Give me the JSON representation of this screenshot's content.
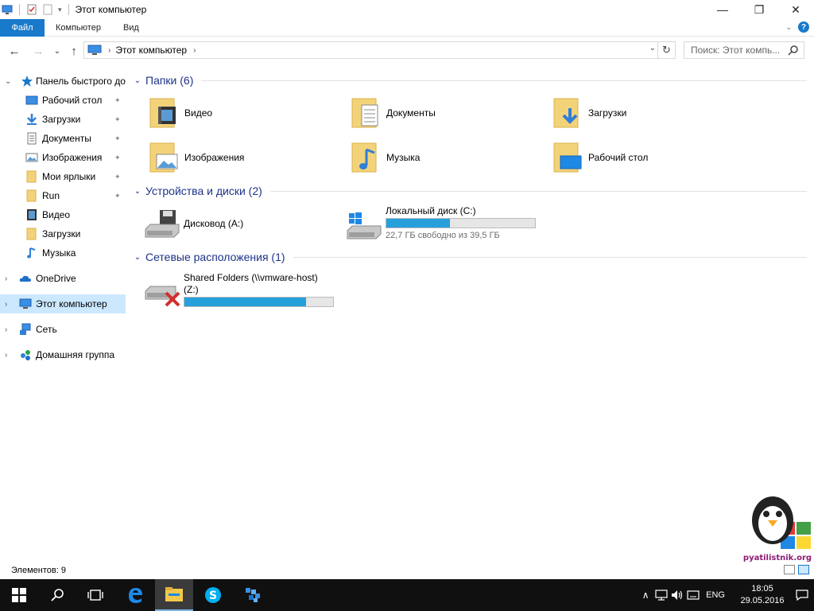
{
  "window": {
    "title": "Этот компьютер",
    "min_glyph": "—",
    "max_glyph": "❐",
    "close_glyph": "✕"
  },
  "ribbon": {
    "tabs": [
      "Файл",
      "Компьютер",
      "Вид"
    ],
    "help_glyph": "?",
    "expand_glyph": "⌄"
  },
  "nav": {
    "back_glyph": "←",
    "forward_glyph": "→",
    "recent_glyph": "⌄",
    "up_glyph": "↑",
    "crumb_sep": "›",
    "crumb": "Этот компьютер",
    "crumb_trail_sep": "›",
    "drop_glyph": "⌄",
    "refresh_glyph": "↻",
    "search_placeholder": "Поиск: Этот компь..."
  },
  "sidebar": {
    "quick_access": "Панель быстрого до",
    "quick_items": [
      {
        "label": "Рабочий стол",
        "pinned": true,
        "icon": "desktop-icon"
      },
      {
        "label": "Загрузки",
        "pinned": true,
        "icon": "downloads-icon"
      },
      {
        "label": "Документы",
        "pinned": true,
        "icon": "documents-icon"
      },
      {
        "label": "Изображения",
        "pinned": true,
        "icon": "pictures-icon"
      },
      {
        "label": "Мои ярлыки",
        "pinned": true,
        "icon": "folder-icon"
      },
      {
        "label": "Run",
        "pinned": true,
        "icon": "folder-icon"
      },
      {
        "label": "Видео",
        "pinned": false,
        "icon": "video-icon"
      },
      {
        "label": "Загрузки",
        "pinned": false,
        "icon": "folder-icon"
      },
      {
        "label": "Музыка",
        "pinned": false,
        "icon": "music-icon"
      }
    ],
    "pin_glyph": "📌",
    "onedrive": "OneDrive",
    "this_pc": "Этот компьютер",
    "network": "Сеть",
    "homegroup": "Домашняя группа",
    "expand_glyph": "›",
    "collapse_glyph": "⌄"
  },
  "groups": {
    "folders": {
      "title": "Папки (6)",
      "items": [
        {
          "label": "Видео",
          "icon": "video-folder-icon"
        },
        {
          "label": "Документы",
          "icon": "documents-folder-icon"
        },
        {
          "label": "Загрузки",
          "icon": "downloads-folder-icon"
        },
        {
          "label": "Изображения",
          "icon": "pictures-folder-icon"
        },
        {
          "label": "Музыка",
          "icon": "music-folder-icon"
        },
        {
          "label": "Рабочий стол",
          "icon": "desktop-folder-icon"
        }
      ]
    },
    "devices": {
      "title": "Устройства и диски (2)",
      "floppy": "Дисковод (A:)",
      "local_disk": {
        "name": "Локальный диск (C:)",
        "free": "22,7 ГБ свободно из 39,5 ГБ",
        "used_fraction": 0.43
      }
    },
    "network": {
      "title": "Сетевые расположения (1)",
      "share": {
        "name_line1": "Shared Folders (\\\\vmware-host)",
        "name_line2": "(Z:)",
        "used_fraction": 0.82
      }
    },
    "collapse_glyph": "⌄"
  },
  "statusbar": {
    "count": "Элементов: 9"
  },
  "watermark": {
    "text": "pyatilistnik.org"
  },
  "taskbar": {
    "lang": "ENG",
    "time": "18:05",
    "date": "29.05.2016",
    "tray_up_glyph": "∧",
    "volume_glyph": "🔊"
  },
  "colors": {
    "accent": "#1979ca",
    "heading": "#1e3287",
    "bar": "#26a0da",
    "selection": "#cce8ff"
  }
}
